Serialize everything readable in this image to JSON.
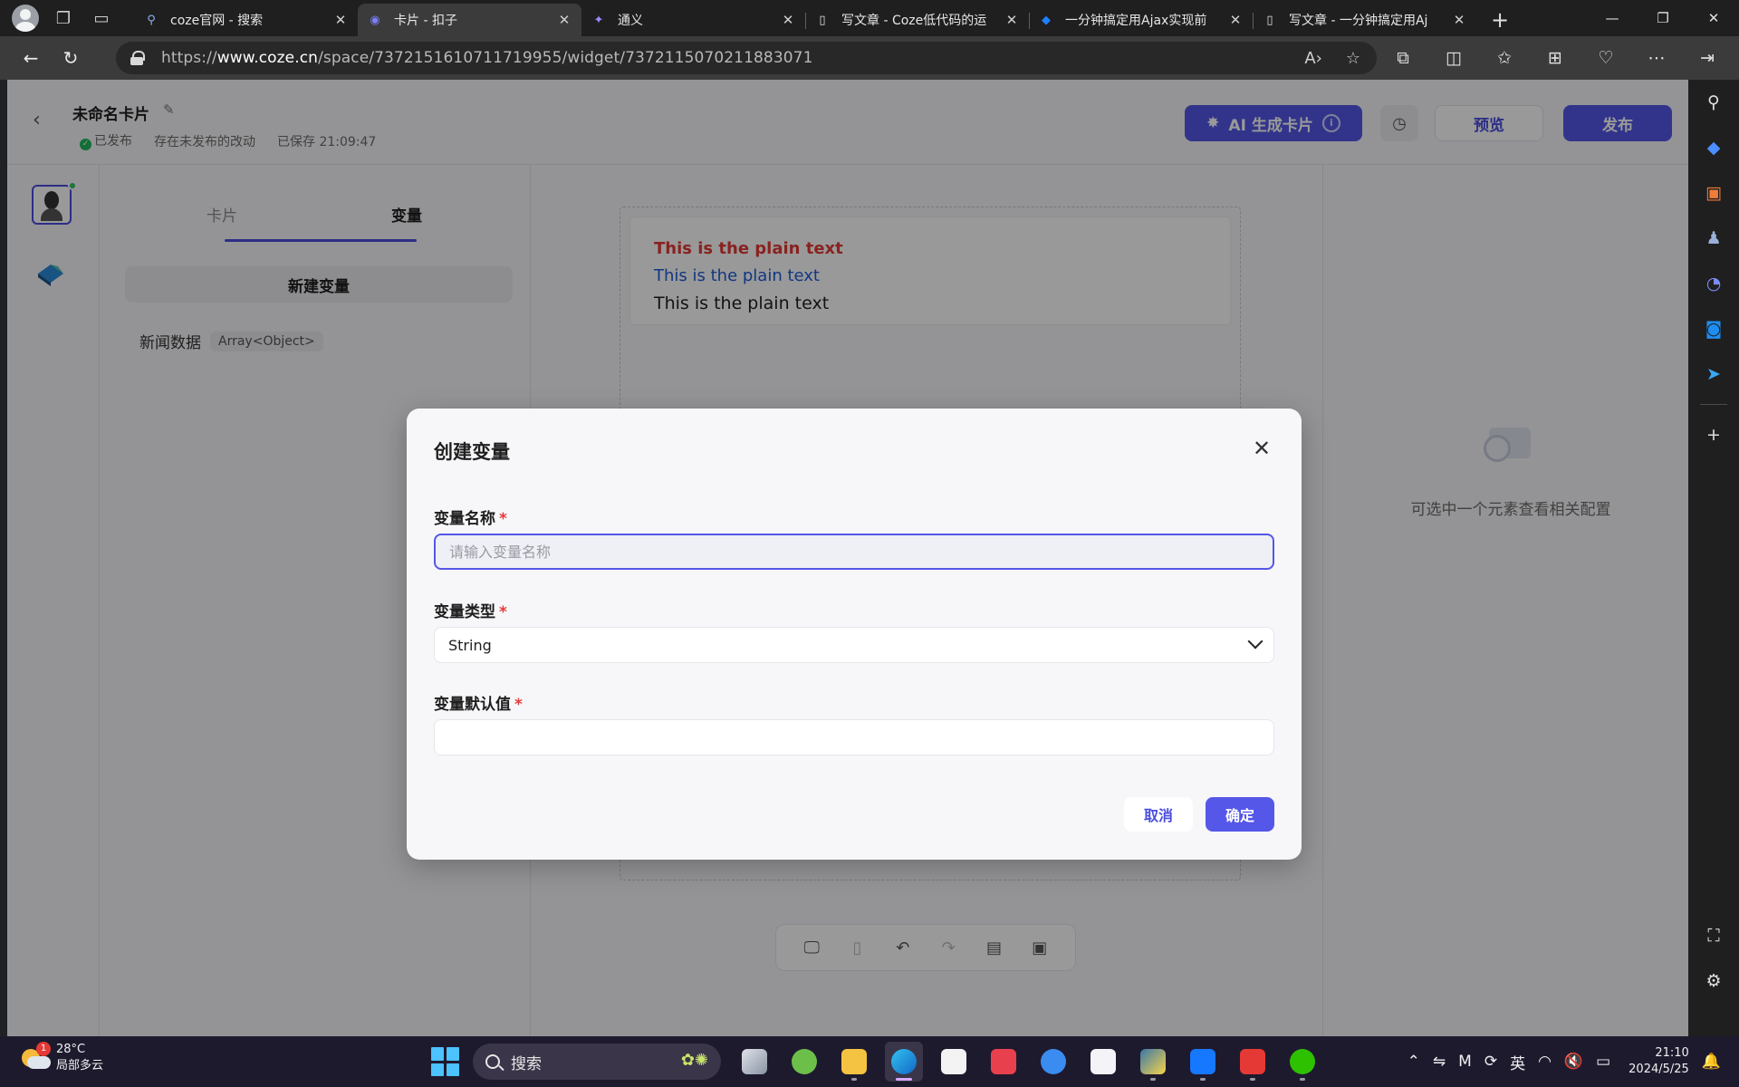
{
  "browser": {
    "tabs": [
      {
        "title": "coze官网 - 搜索",
        "icon": "search-icon",
        "active": false
      },
      {
        "title": "卡片 - 扣子",
        "icon": "coze-icon",
        "active": true
      },
      {
        "title": "通义",
        "icon": "tongyi-icon",
        "active": false
      },
      {
        "title": "写文章 - Coze低代码的运",
        "icon": "doc-icon",
        "active": false
      },
      {
        "title": "一分钟搞定用Ajax实现前",
        "icon": "juejin-icon",
        "active": false
      },
      {
        "title": "写文章 - 一分钟搞定用Aj",
        "icon": "doc-icon",
        "active": false
      }
    ],
    "url_prefix": "https://",
    "url_host": "www.coze.cn",
    "url_path": "/space/7372151610711719955/widget/7372115070211883071"
  },
  "header": {
    "title": "未命名卡片",
    "status_published": "已发布",
    "status_unpublished_changes": "存在未发布的改动",
    "saved_at": "已保存 21:09:47",
    "ai_button": "AI 生成卡片",
    "preview_button": "预览",
    "publish_button": "发布"
  },
  "left_panel": {
    "tab_card": "卡片",
    "tab_variables": "变量",
    "new_variable_button": "新建变量",
    "variables": [
      {
        "name": "新闻数据",
        "type": "Array<Object>"
      }
    ]
  },
  "canvas": {
    "text_lines": [
      "This is the plain text",
      "This is the plain text",
      "This is the plain text"
    ]
  },
  "right_panel": {
    "empty_text": "可选中一个元素查看相关配置"
  },
  "modal": {
    "title": "创建变量",
    "name_label": "变量名称",
    "name_placeholder": "请输入变量名称",
    "name_value": "",
    "type_label": "变量类型",
    "type_value": "String",
    "default_label": "变量默认值",
    "default_value": "",
    "required_mark": "*",
    "cancel_button": "取消",
    "ok_button": "确定"
  },
  "taskbar": {
    "weather_temp": "28°C",
    "weather_desc": "局部多云",
    "weather_badge": "1",
    "search_label": "搜索",
    "ime_label": "英",
    "time": "21:10",
    "date": "2024/5/25"
  },
  "colors": {
    "accent": "#5457e8",
    "required": "#e53935",
    "text_red": "#e53935",
    "text_blue": "#1e5bd8"
  }
}
